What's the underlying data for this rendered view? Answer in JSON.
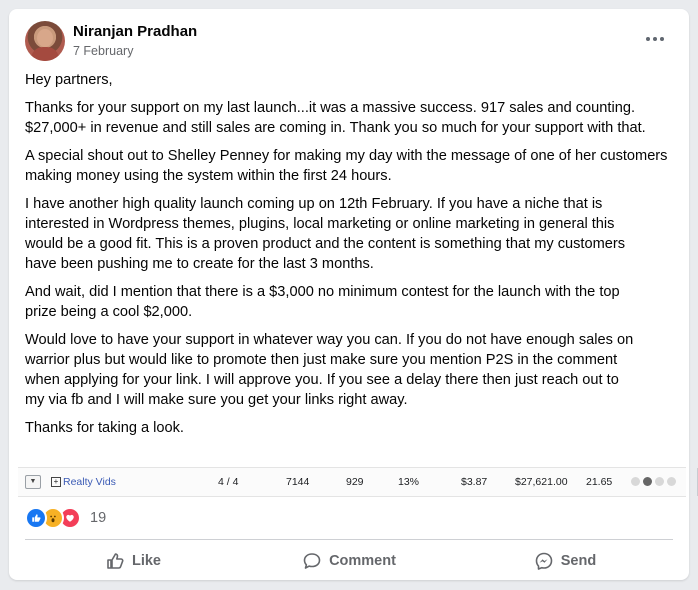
{
  "post": {
    "author": "Niranjan Pradhan",
    "date": "7 February",
    "paragraphs": [
      "Hey partners,",
      "Thanks for your support on my last launch...it was a massive success. 917 sales and counting. $27,000+ in revenue and still sales are coming in. Thank you so much for your support with that.",
      "A special shout out to Shelley Penney for making my day with the message of one of her customers making money using the system within the first 24 hours.",
      "I have another high quality launch coming up on 12th February. If you have a niche that is\ninterested in Wordpress themes, plugins, local marketing or online marketing in general this\nwould be a good fit. This is a proven product and the content is something that my customers\nhave been pushing me to create for the last 3 months.",
      "And wait, did I mention that there is a $3,000 no minimum contest for the launch with the top\nprize being a cool $2,000.",
      "Would love to have your support in whatever way you can. If you do not have enough sales on\nwarrior plus but would like to promote then just make sure you mention P2S in the comment\nwhen applying for your link. I will approve you. If you see a delay there then just reach out to\nmy via fb and I will make sure you get your links right away.",
      "Thanks for taking a look."
    ]
  },
  "stats_row": {
    "vendor": "Realty Vids",
    "cells": [
      "4 / 4",
      "7144",
      "929",
      "13%",
      "$3.87",
      "$27,621.00",
      "21.65"
    ]
  },
  "reactions": {
    "count": "19",
    "types": [
      "like",
      "wow",
      "love"
    ]
  },
  "actions": {
    "like": "Like",
    "comment": "Comment",
    "send": "Send"
  },
  "colors": {
    "like_blue": "#1877f2",
    "wow_yellow": "#f7b125",
    "love_red": "#f33e58",
    "secondary_text": "#65676b"
  }
}
